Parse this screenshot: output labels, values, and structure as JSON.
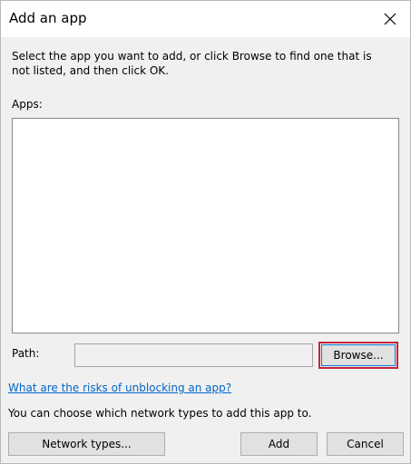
{
  "dialog": {
    "title": "Add an app",
    "close_icon": "close-icon",
    "instructions": "Select the app you want to add, or click Browse to find one that is not listed, and then click OK.",
    "apps_label": "Apps:",
    "apps_items": [],
    "path_label": "Path:",
    "path_value": "",
    "browse_label": "Browse...",
    "risk_link": "What are the risks of unblocking an app?",
    "network_note": "You can choose which network types to add this app to.",
    "buttons": {
      "network_types": "Network types...",
      "add": "Add",
      "cancel": "Cancel"
    }
  },
  "colors": {
    "browse_highlight": "#c3233d",
    "link": "#0066cc",
    "focus_border": "#0078d7"
  }
}
